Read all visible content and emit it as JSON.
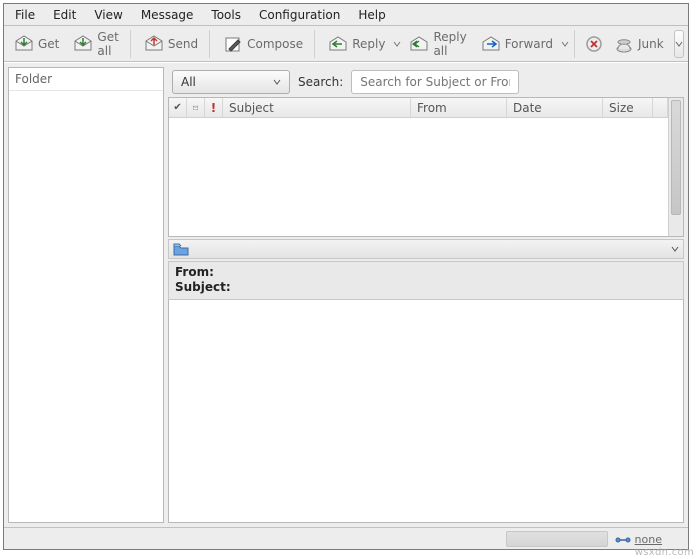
{
  "menu": {
    "file": "File",
    "edit": "Edit",
    "view": "View",
    "message": "Message",
    "tools": "Tools",
    "configuration": "Configuration",
    "help": "Help"
  },
  "toolbar": {
    "get": "Get",
    "get_all": "Get all",
    "send": "Send",
    "compose": "Compose",
    "reply": "Reply",
    "reply_all": "Reply all",
    "forward": "Forward",
    "junk": "Junk"
  },
  "folder_pane": {
    "header": "Folder"
  },
  "search": {
    "filter_label": "All",
    "label": "Search:",
    "placeholder": "Search for Subject or From"
  },
  "columns": {
    "check": "✔",
    "envelope": "✉",
    "flag": "❗",
    "subject": "Subject",
    "from": "From",
    "date": "Date",
    "size": "Size"
  },
  "preview": {
    "from_label": "From:",
    "subject_label": "Subject:"
  },
  "status": {
    "net_label": "none"
  },
  "watermark": "wsxdn.com"
}
